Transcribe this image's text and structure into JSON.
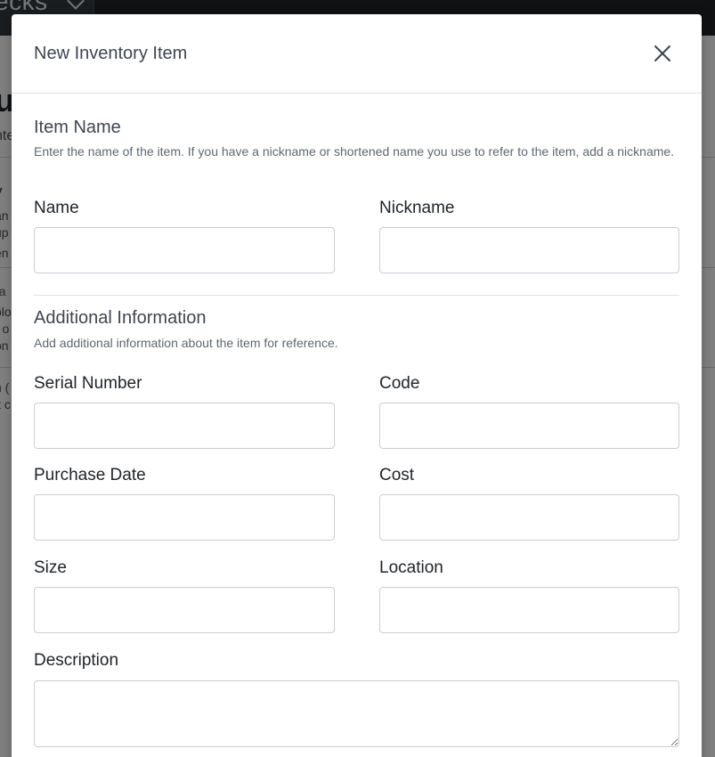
{
  "background": {
    "brand_text": "ecks",
    "title": "u",
    "subtitle": "nte",
    "fragments": [
      "y",
      "an",
      "up",
      "en",
      "ra",
      "olo",
      "r o",
      "on",
      "n (",
      "it c"
    ]
  },
  "modal": {
    "title": "New Inventory Item",
    "close_icon": "close-icon"
  },
  "sections": {
    "item_name": {
      "title": "Item Name",
      "description": "Enter the name of the item. If you have a nickname or shortened name you use to refer to the item, add a nickname."
    },
    "additional": {
      "title": "Additional Information",
      "description": "Add additional information about the item for reference."
    }
  },
  "fields": {
    "name": {
      "label": "Name",
      "value": "",
      "placeholder": ""
    },
    "nickname": {
      "label": "Nickname",
      "value": "",
      "placeholder": ""
    },
    "serial_number": {
      "label": "Serial Number",
      "value": "",
      "placeholder": ""
    },
    "code": {
      "label": "Code",
      "value": "",
      "placeholder": ""
    },
    "purchase_date": {
      "label": "Purchase Date",
      "value": "",
      "placeholder": ""
    },
    "cost": {
      "label": "Cost",
      "value": "",
      "placeholder": ""
    },
    "size": {
      "label": "Size",
      "value": "",
      "placeholder": ""
    },
    "location": {
      "label": "Location",
      "value": "",
      "placeholder": ""
    },
    "description": {
      "label": "Description",
      "value": "",
      "placeholder": ""
    }
  },
  "colors": {
    "overlay": "#000000",
    "topbar": "#1f2327",
    "input_border": "#c9ced4",
    "divider": "#dee2e6"
  }
}
